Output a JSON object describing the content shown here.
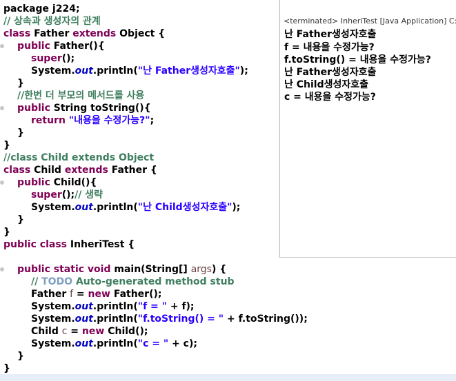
{
  "editor": {
    "lines": {
      "l1": [
        "package j224;"
      ],
      "l2": [
        "// 상속과 생성자의 관계"
      ],
      "l3": [
        "class",
        " Father ",
        "extends",
        " Object {"
      ],
      "l4": [
        "public",
        " Father(){"
      ],
      "l5": [
        "super",
        "();"
      ],
      "l6": [
        "System.",
        "out",
        ".println(",
        "\"난 Father생성자호출\"",
        ");"
      ],
      "l7": [
        "}"
      ],
      "l8": [
        "//한번 더 부모의 메서드를 사용"
      ],
      "l9": [
        "public",
        " String toString(){"
      ],
      "l10": [
        "return",
        " ",
        "\"내용을 수정가능?\"",
        ";"
      ],
      "l11": [
        "}"
      ],
      "l12": [
        "}"
      ],
      "l13": [
        "//class Child extends Object"
      ],
      "l14": [
        "class",
        " Child ",
        "extends",
        " Father {"
      ],
      "l15": [
        "public",
        " Child(){"
      ],
      "l16": [
        "super",
        "();",
        "// 생략"
      ],
      "l17": [
        "System.",
        "out",
        ".println(",
        "\"난 Child생성자호출\"",
        ");"
      ],
      "l18": [
        "}"
      ],
      "l19": [
        "}"
      ],
      "l20": [
        "public class",
        " InheriTest {"
      ],
      "l21": [
        "public static void",
        " main(String[] ",
        "args",
        ") {"
      ],
      "l22": [
        "// ",
        "TODO",
        " Auto-generated method stub"
      ],
      "l23": [
        "Father ",
        "f",
        " = ",
        "new",
        " Father();"
      ],
      "l24": [
        "System.",
        "out",
        ".println(",
        "\"f = \"",
        " + f);"
      ],
      "l25": [
        "System.",
        "out",
        ".println(",
        "\"f.toString() = \"",
        " + f.toString());"
      ],
      "l26": [
        "Child ",
        "c",
        " = ",
        "new",
        " Child();"
      ],
      "l27": [
        "System.",
        "out",
        ".println(",
        "\"c = \"",
        " + c);"
      ],
      "l28": [
        "}"
      ],
      "l29": [
        "}"
      ]
    }
  },
  "console": {
    "header": "<terminated> InheriTest [Java Application] C:\\",
    "output": [
      "난 Father생성자호출",
      "f = 내용을 수정가능?",
      "f.toString() = 내용을 수정가능?",
      "난 Father생성자호출",
      "난 Child생성자호출",
      "c = 내용을 수정가능?"
    ]
  },
  "colors": {
    "keyword": "#7f0055",
    "comment": "#3f7f5f",
    "string": "#2a00ff",
    "field": "#0000c0",
    "todo": "#7f9fbf"
  }
}
